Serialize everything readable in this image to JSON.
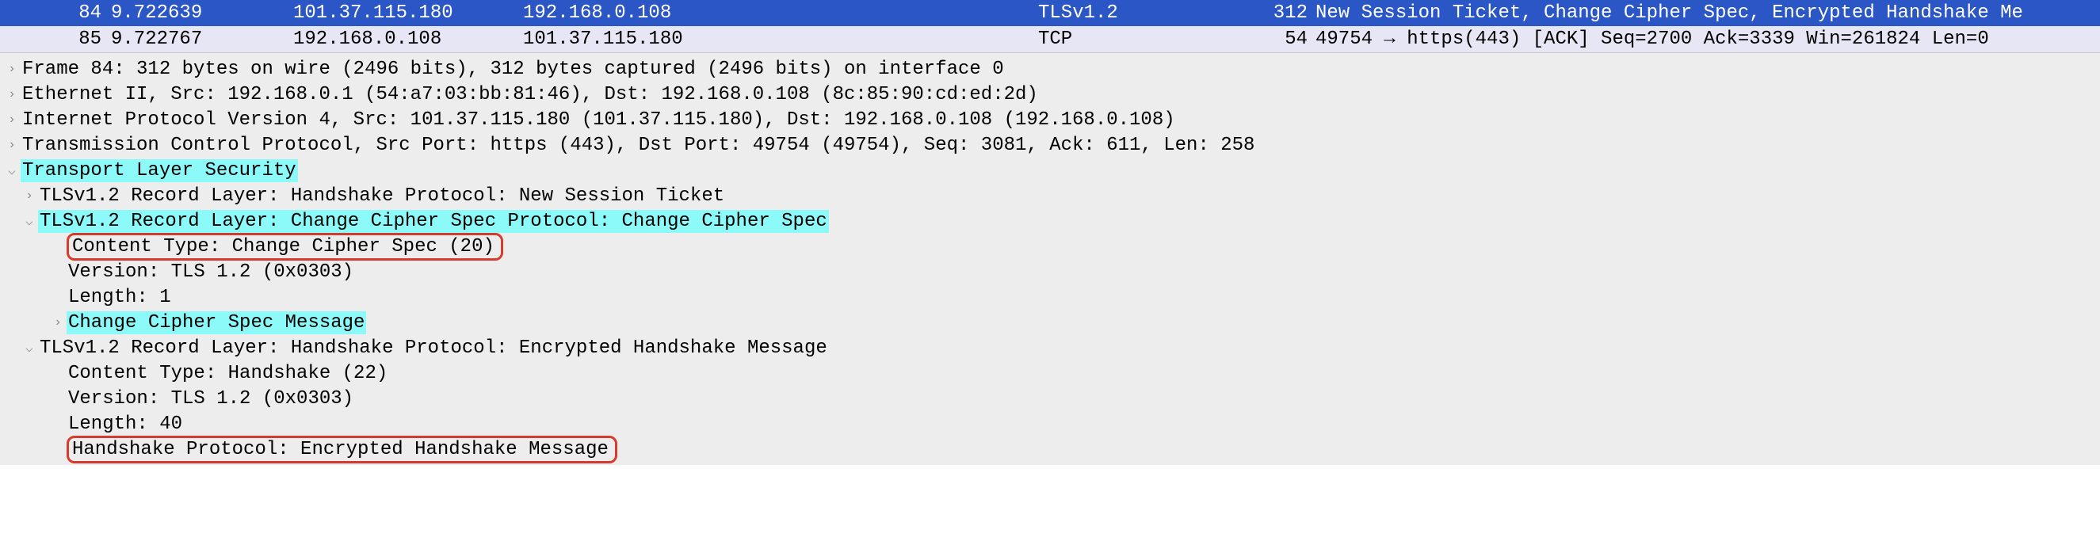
{
  "packets": [
    {
      "no": "84",
      "time": "9.722639",
      "src": "101.37.115.180",
      "dst": "192.168.0.108",
      "proto": "TLSv1.2",
      "len": "312",
      "info": "New Session Ticket, Change Cipher Spec, Encrypted Handshake Me"
    },
    {
      "no": "85",
      "time": "9.722767",
      "src": "192.168.0.108",
      "dst": "101.37.115.180",
      "proto": "TCP",
      "len": "54",
      "info": "49754 → https(443) [ACK] Seq=2700 Ack=3339 Win=261824 Len=0"
    }
  ],
  "tree": {
    "frame": "Frame 84: 312 bytes on wire (2496 bits), 312 bytes captured (2496 bits) on interface 0",
    "eth": "Ethernet II, Src: 192.168.0.1 (54:a7:03:bb:81:46), Dst: 192.168.0.108 (8c:85:90:cd:ed:2d)",
    "ip": "Internet Protocol Version 4, Src: 101.37.115.180 (101.37.115.180), Dst: 192.168.0.108 (192.168.0.108)",
    "tcp": "Transmission Control Protocol, Src Port: https (443), Dst Port: 49754 (49754), Seq: 3081, Ack: 611, Len: 258",
    "tls": "Transport Layer Security",
    "rec1": "TLSv1.2 Record Layer: Handshake Protocol: New Session Ticket",
    "rec2": "TLSv1.2 Record Layer: Change Cipher Spec Protocol: Change Cipher Spec",
    "rec2_ct": "Content Type: Change Cipher Spec (20)",
    "rec2_ver": "Version: TLS 1.2 (0x0303)",
    "rec2_len": "Length: 1",
    "rec2_msg": "Change Cipher Spec Message",
    "rec3": "TLSv1.2 Record Layer: Handshake Protocol: Encrypted Handshake Message",
    "rec3_ct": "Content Type: Handshake (22)",
    "rec3_ver": "Version: TLS 1.2 (0x0303)",
    "rec3_len": "Length: 40",
    "rec3_hp": "Handshake Protocol: Encrypted Handshake Message"
  }
}
